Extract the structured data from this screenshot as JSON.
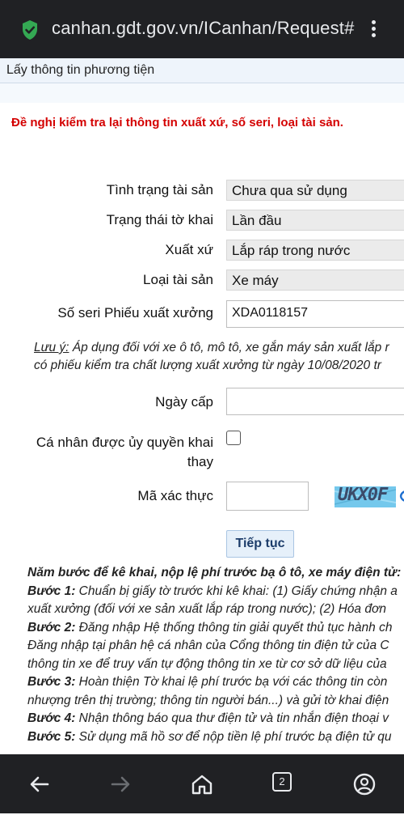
{
  "browser": {
    "url": "canhan.gdt.gov.vn/ICanhan/Request#"
  },
  "page": {
    "title": "Lấy thông tin phương tiện",
    "warning": "Đề nghị kiểm tra lại thông tin xuất xứ, số seri, loại tài sản."
  },
  "form": {
    "rows": [
      {
        "label": "Tình trạng tài sản",
        "value": "Chưa qua sử dụng"
      },
      {
        "label": "Trạng thái tờ khai",
        "value": "Lần đầu"
      },
      {
        "label": "Xuất xứ",
        "value": "Lắp ráp trong nước"
      },
      {
        "label": "Loại tài sản",
        "value": "Xe máy"
      }
    ],
    "serial_label": "Số seri Phiếu xuất xưởng",
    "serial_value": "XDA0118157",
    "note_label": "Lưu ý:",
    "note_line1": " Áp dụng đối với xe ô tô, mô tô, xe gắn máy sản xuất lắp r",
    "note_line2": "có phiếu kiểm tra chất lượng xuất xưởng từ ngày 10/08/2020 tr",
    "issue_date_label": "Ngày cấp",
    "issue_date_value": "",
    "authorized_label_1": "Cá nhân được ủy quyền khai",
    "authorized_label_2": "thay",
    "authorized_checked": false,
    "captcha_label": "Mã xác thực",
    "captcha_value": "",
    "captcha_text": "UKX0F",
    "submit_label": "Tiếp tục"
  },
  "steps": {
    "heading": "Năm bước để kê khai, nộp lệ phí trước bạ ô tô, xe máy điện tử:",
    "lines": [
      {
        "bold": "Bước 1:",
        "text": " Chuẩn bị giấy tờ trước khi kê khai: (1) Giấy chứng nhận a"
      },
      {
        "bold": "",
        "text": "xuất xưởng (đối với xe sản xuất lắp ráp trong nước); (2) Hóa đơn"
      },
      {
        "bold": "Bước 2:",
        "text": " Đăng nhập Hệ thống thông tin giải quyết thủ tục hành ch"
      },
      {
        "bold": "",
        "text": "Đăng nhập tại phân hệ cá nhân của Cổng thông tin điện tử của C"
      },
      {
        "bold": "",
        "text": "thông tin xe để truy vấn tự động thông tin xe từ cơ sở dữ liệu của"
      },
      {
        "bold": "Bước 3:",
        "text": " Hoàn thiện Tờ khai lệ phí trước bạ với các thông tin còn"
      },
      {
        "bold": "",
        "text": "nhượng trên thị trường; thông tin người bán...) và gửi tờ khai điện"
      },
      {
        "bold": "Bước 4:",
        "text": " Nhận thông báo qua thư điện tử và tin nhắn điện thoại v"
      },
      {
        "bold": "Bước 5:",
        "text": " Sử dụng mã hồ sơ để nộp tiền lệ phí trước bạ điện tử qu"
      }
    ]
  },
  "navbar": {
    "tab_count": "2"
  },
  "colors": {
    "warning": "#d40000",
    "header_bg": "#eef4fb",
    "chrome_bg": "#202124",
    "captcha_bg": "#74c8ec",
    "secure_icon": "#34a853"
  }
}
